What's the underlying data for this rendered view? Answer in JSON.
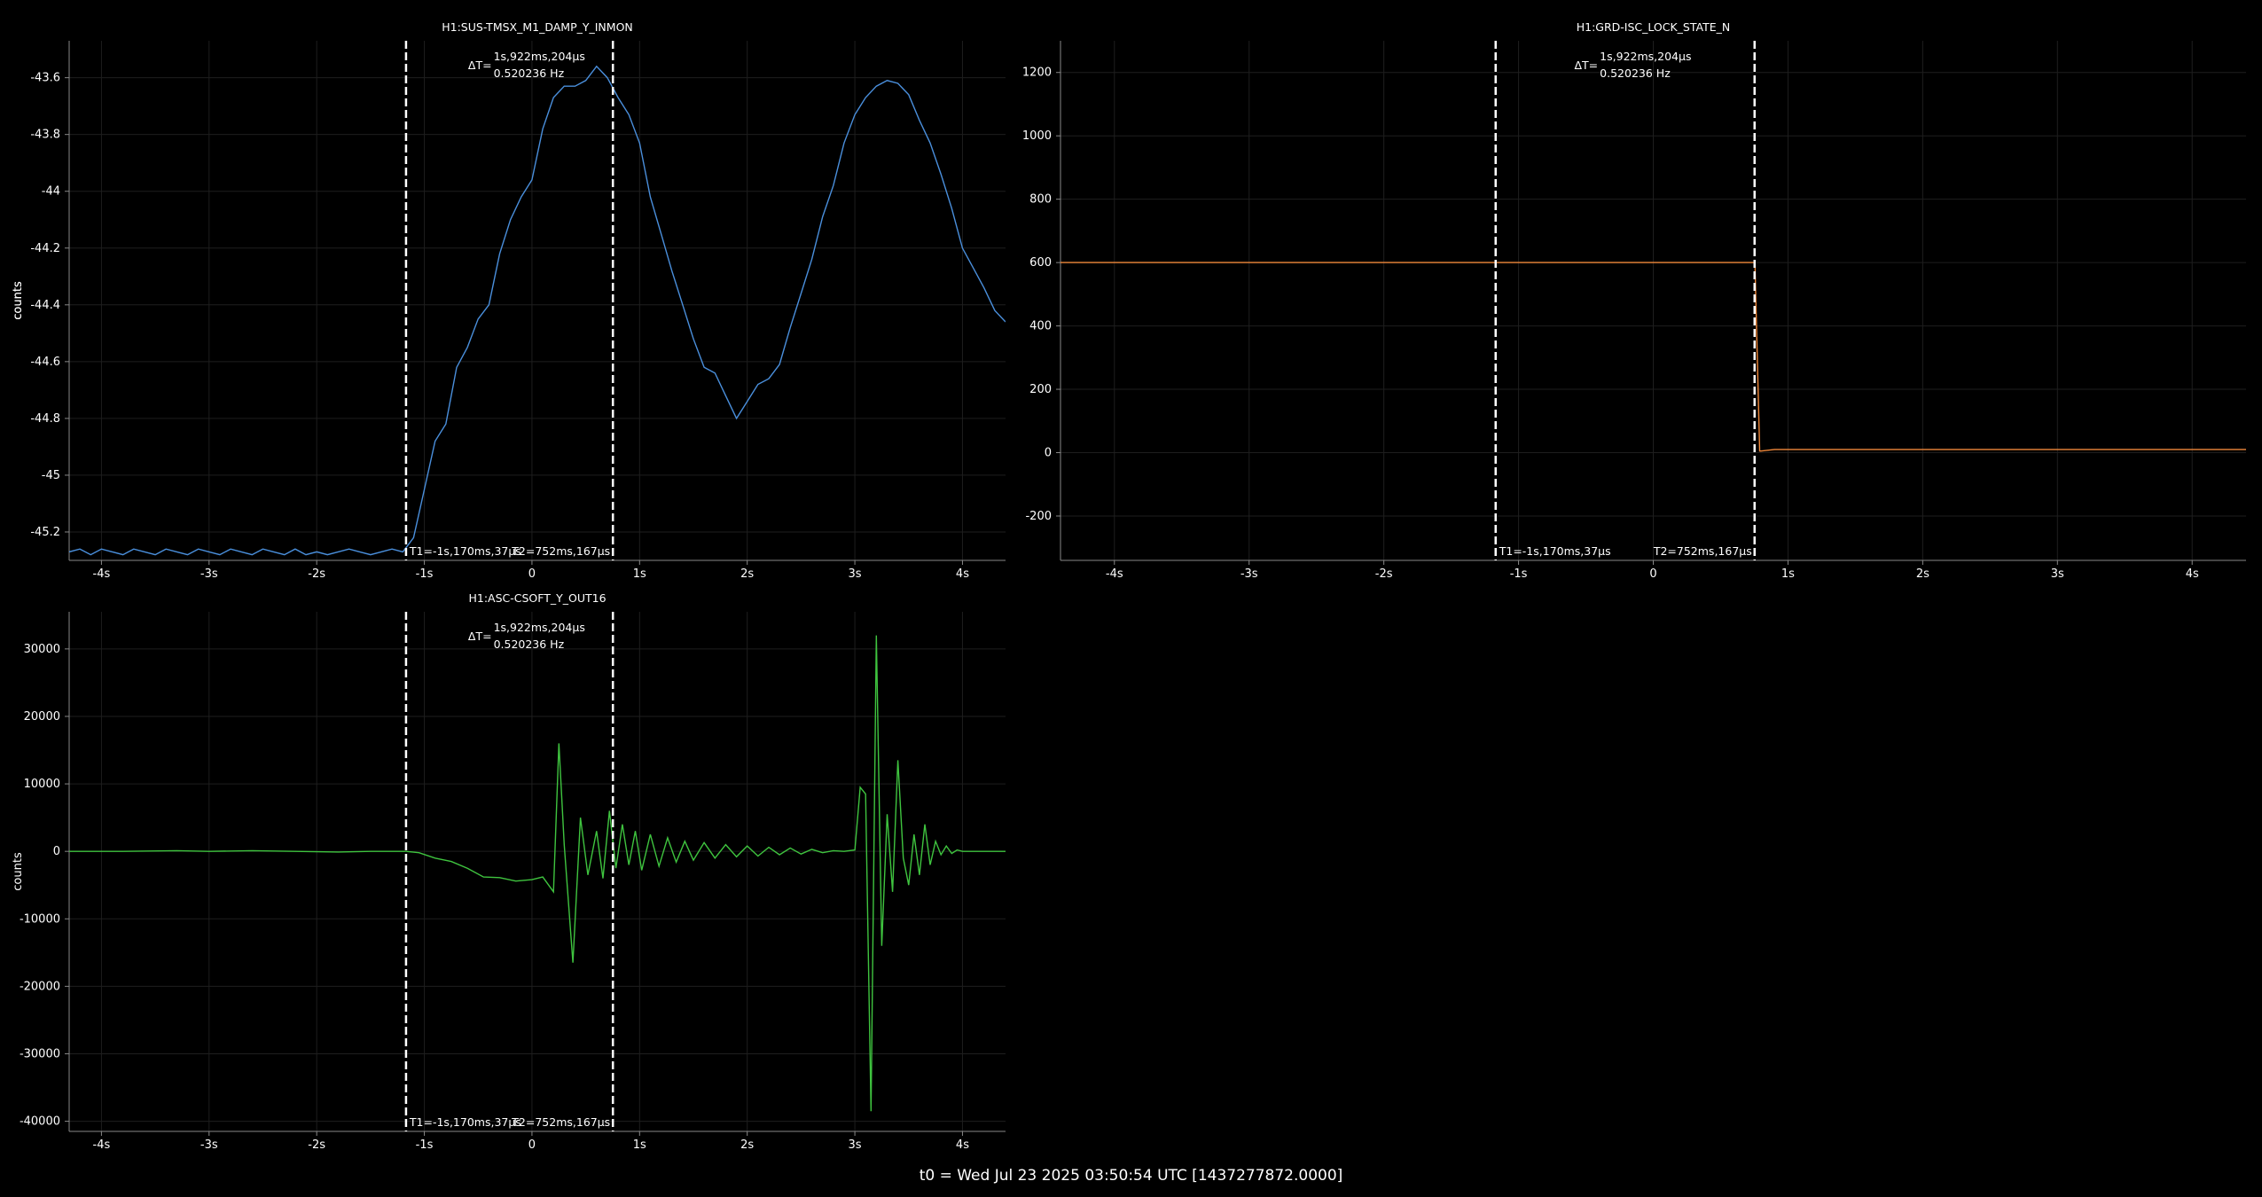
{
  "footer": "t0 = Wed Jul 23 2025 03:50:54 UTC [1437277872.0000]",
  "chart_data": [
    {
      "type": "line",
      "title": "H1:SUS-TMSX_M1_DAMP_Y_INMON",
      "ylabel": "counts",
      "xlim": [
        -4.3,
        4.4
      ],
      "ylim": [
        -45.3,
        -43.47
      ],
      "x_ticks": [
        -4,
        -3,
        -2,
        -1,
        0,
        1,
        2,
        3,
        4
      ],
      "x_tick_labels": [
        "-4s",
        "-3s",
        "-2s",
        "-1s",
        "0",
        "1s",
        "2s",
        "3s",
        "4s"
      ],
      "y_ticks": [
        -45.2,
        -45,
        -44.8,
        -44.6,
        -44.4,
        -44.2,
        -44,
        -43.8,
        -43.6
      ],
      "y_tick_labels": [
        "-45.2",
        "-45",
        "-44.8",
        "-44.6",
        "-44.4",
        "-44.2",
        "-44",
        "-43.8",
        "-43.6"
      ],
      "grid": true,
      "color": "#4a8fdc",
      "cursors": [
        -1.17,
        0.752
      ],
      "cursor_labels": {
        "t1": "T1=-1s,170ms,37µs",
        "t2": "T2=752ms,167µs"
      },
      "delta": {
        "prefix": "ΔT=",
        "line1": "1s,922ms,204µs",
        "line2": "0.520236 Hz"
      },
      "series": [
        {
          "x": [
            -4.3,
            -4.2,
            -4.1,
            -4.0,
            -3.9,
            -3.8,
            -3.7,
            -3.6,
            -3.5,
            -3.4,
            -3.3,
            -3.2,
            -3.1,
            -3.0,
            -2.9,
            -2.8,
            -2.7,
            -2.6,
            -2.5,
            -2.4,
            -2.3,
            -2.2,
            -2.1,
            -2.0,
            -1.9,
            -1.8,
            -1.7,
            -1.6,
            -1.5,
            -1.4,
            -1.3,
            -1.2,
            -1.1,
            -1.0,
            -0.9,
            -0.8,
            -0.7,
            -0.6,
            -0.5,
            -0.4,
            -0.3,
            -0.2,
            -0.1,
            0.0,
            0.1,
            0.2,
            0.3,
            0.4,
            0.5,
            0.6,
            0.7,
            0.8,
            0.9,
            1.0,
            1.1,
            1.2,
            1.3,
            1.4,
            1.5,
            1.6,
            1.7,
            1.8,
            1.9,
            2.0,
            2.1,
            2.2,
            2.3,
            2.4,
            2.5,
            2.6,
            2.7,
            2.8,
            2.9,
            3.0,
            3.1,
            3.2,
            3.3,
            3.4,
            3.5,
            3.6,
            3.7,
            3.8,
            3.9,
            4.0,
            4.1,
            4.2,
            4.3,
            4.4
          ],
          "y": [
            -45.27,
            -45.26,
            -45.28,
            -45.26,
            -45.27,
            -45.28,
            -45.26,
            -45.27,
            -45.28,
            -45.26,
            -45.27,
            -45.28,
            -45.26,
            -45.27,
            -45.28,
            -45.26,
            -45.27,
            -45.28,
            -45.26,
            -45.27,
            -45.28,
            -45.26,
            -45.28,
            -45.27,
            -45.28,
            -45.27,
            -45.26,
            -45.27,
            -45.28,
            -45.27,
            -45.26,
            -45.27,
            -45.22,
            -45.05,
            -44.88,
            -44.82,
            -44.62,
            -44.55,
            -44.45,
            -44.4,
            -44.22,
            -44.1,
            -44.02,
            -43.96,
            -43.78,
            -43.67,
            -43.63,
            -43.63,
            -43.61,
            -43.56,
            -43.6,
            -43.67,
            -43.73,
            -43.83,
            -44.02,
            -44.15,
            -44.28,
            -44.4,
            -44.52,
            -44.62,
            -44.64,
            -44.72,
            -44.8,
            -44.74,
            -44.68,
            -44.66,
            -44.61,
            -44.48,
            -44.36,
            -44.24,
            -44.09,
            -43.98,
            -43.83,
            -43.73,
            -43.67,
            -43.63,
            -43.61,
            -43.62,
            -43.66,
            -43.75,
            -43.83,
            -43.94,
            -44.06,
            -44.2,
            -44.27,
            -44.34,
            -44.42,
            -44.46
          ]
        }
      ]
    },
    {
      "type": "line",
      "title": "H1:GRD-ISC_LOCK_STATE_N",
      "ylabel": "counts",
      "xlim": [
        -4.4,
        4.4
      ],
      "ylim": [
        -340,
        1300
      ],
      "x_ticks": [
        -4,
        -3,
        -2,
        -1,
        0,
        1,
        2,
        3,
        4
      ],
      "x_tick_labels": [
        "-4s",
        "-3s",
        "-2s",
        "-1s",
        "0",
        "1s",
        "2s",
        "3s",
        "4s"
      ],
      "y_ticks": [
        -200,
        0,
        200,
        400,
        600,
        800,
        1000,
        1200
      ],
      "y_tick_labels": [
        "-200",
        "0",
        "200",
        "400",
        "600",
        "800",
        "1000",
        "1200"
      ],
      "grid": true,
      "color": "#f0883a",
      "cursors": [
        -1.17,
        0.752
      ],
      "cursor_labels": {
        "t1": "T1=-1s,170ms,37µs",
        "t2": "T2=752ms,167µs"
      },
      "delta": {
        "prefix": "ΔT=",
        "line1": "1s,922ms,204µs",
        "line2": "0.520236 Hz"
      },
      "series": [
        {
          "x": [
            -4.4,
            0.755,
            0.76,
            0.79,
            0.8,
            0.9,
            4.4
          ],
          "y": [
            600,
            600,
            500,
            5,
            5,
            10,
            10
          ]
        }
      ]
    },
    {
      "type": "line",
      "title": "H1:ASC-CSOFT_Y_OUT16",
      "ylabel": "counts",
      "xlim": [
        -4.3,
        4.4
      ],
      "ylim": [
        -41500,
        35500
      ],
      "x_ticks": [
        -4,
        -3,
        -2,
        -1,
        0,
        1,
        2,
        3,
        4
      ],
      "x_tick_labels": [
        "-4s",
        "-3s",
        "-2s",
        "-1s",
        "0",
        "1s",
        "2s",
        "3s",
        "4s"
      ],
      "y_ticks": [
        -40000,
        -30000,
        -20000,
        -10000,
        0,
        10000,
        20000,
        30000
      ],
      "y_tick_labels": [
        "-40000",
        "-30000",
        "-20000",
        "-10000",
        "0",
        "10000",
        "20000",
        "30000"
      ],
      "grid": true,
      "color": "#3fc43f",
      "cursors": [
        -1.17,
        0.752
      ],
      "cursor_labels": {
        "t1": "T1=-1s,170ms,37µs",
        "t2": "T2=752ms,167µs"
      },
      "delta": {
        "prefix": "ΔT=",
        "line1": "1s,922ms,204µs",
        "line2": "0.520236 Hz"
      },
      "series": [
        {
          "x": [
            -4.3,
            -3.8,
            -3.3,
            -3.0,
            -2.6,
            -2.2,
            -1.8,
            -1.5,
            -1.17,
            -1.05,
            -0.9,
            -0.75,
            -0.6,
            -0.45,
            -0.3,
            -0.15,
            0.0,
            0.1,
            0.2,
            0.25,
            0.3,
            0.38,
            0.45,
            0.52,
            0.6,
            0.66,
            0.72,
            0.78,
            0.84,
            0.9,
            0.96,
            1.02,
            1.1,
            1.18,
            1.26,
            1.34,
            1.42,
            1.5,
            1.6,
            1.7,
            1.8,
            1.9,
            2.0,
            2.1,
            2.2,
            2.3,
            2.4,
            2.5,
            2.6,
            2.7,
            2.8,
            2.9,
            3.0,
            3.05,
            3.1,
            3.15,
            3.2,
            3.25,
            3.3,
            3.35,
            3.4,
            3.45,
            3.5,
            3.55,
            3.6,
            3.65,
            3.7,
            3.75,
            3.8,
            3.85,
            3.9,
            3.95,
            4.0,
            4.05,
            4.1,
            4.15,
            4.2,
            4.3,
            4.4
          ],
          "y": [
            0,
            0,
            100,
            0,
            100,
            0,
            -100,
            0,
            0,
            -200,
            -1000,
            -1500,
            -2500,
            -3800,
            -3900,
            -4400,
            -4200,
            -3800,
            -6000,
            16000,
            1000,
            -16500,
            5000,
            -3500,
            3000,
            -4000,
            6000,
            -2500,
            4000,
            -2000,
            3000,
            -2800,
            2500,
            -2200,
            2000,
            -1600,
            1500,
            -1300,
            1300,
            -1000,
            1000,
            -800,
            800,
            -700,
            600,
            -500,
            500,
            -400,
            300,
            -200,
            100,
            0,
            200,
            9500,
            8500,
            -38500,
            32000,
            -14000,
            5500,
            -6000,
            13500,
            -1000,
            -5000,
            2500,
            -3500,
            4000,
            -2000,
            1500,
            -500,
            800,
            -300,
            200,
            0,
            0,
            0,
            0,
            0,
            0,
            0
          ]
        }
      ]
    }
  ]
}
